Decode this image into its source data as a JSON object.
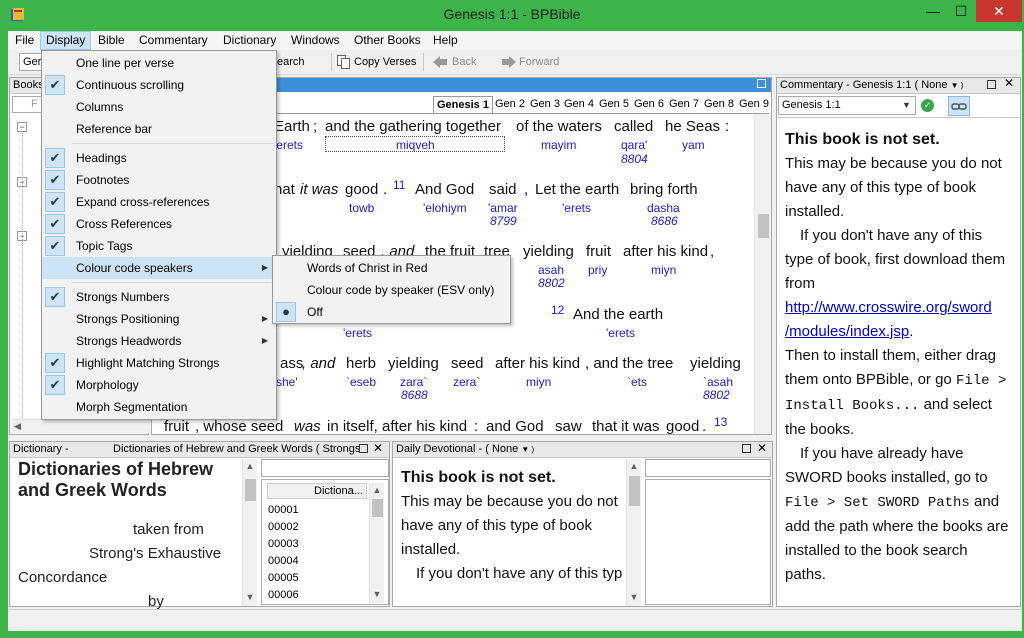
{
  "window": {
    "title": "Genesis 1:1 - BPBible",
    "min_label": "—",
    "max_label": "☐",
    "close_label": "✕"
  },
  "menubar": [
    "File",
    "Display",
    "Bible",
    "Commentary",
    "Dictionary",
    "Windows",
    "Other Books",
    "Help"
  ],
  "toolbar": {
    "book_field": "Ger",
    "search_label": "earch",
    "copy_verses": "Copy Verses",
    "back": "Back",
    "forward": "Forward"
  },
  "books_panel": {
    "title": "Books",
    "filter_placeholder": "F"
  },
  "bible": {
    "tabs": [
      "Genesis 1",
      "Gen 2",
      "Gen 3",
      "Gen 4",
      "Gen 5",
      "Gen 6",
      "Gen 7",
      "Gen 8",
      "Gen 9"
    ],
    "line1": {
      "words": [
        "Earth",
        ";",
        "and the gathering together",
        "of the waters",
        "called",
        "he Seas",
        ":"
      ],
      "strongs": [
        "'erets",
        "miqveh",
        "mayim",
        "qara'",
        "yam"
      ],
      "num": "8804"
    },
    "line2": {
      "words": [
        "nat",
        "it was",
        "good",
        ".",
        "And God",
        "said",
        ",",
        "Let the earth",
        "bring forth"
      ],
      "verse": "11",
      "strongs": [
        "towb",
        "'elohiym",
        "'amar",
        "'erets",
        "dasha"
      ],
      "nums": [
        "8799",
        "8686"
      ]
    },
    "line3": {
      "words": [
        "yielding",
        "seed",
        ", and",
        "the fruit",
        "tree",
        "yielding",
        "fruit",
        "after his kind",
        ","
      ],
      "strongs": [
        "asah",
        "priy",
        "miyn"
      ],
      "num": "8802"
    },
    "line4": {
      "words": [
        "And the earth"
      ],
      "verse": "12",
      "strongs": [
        "'erets",
        "'erets"
      ]
    },
    "line5": {
      "words": [
        "ass",
        ", and",
        "herb",
        "yielding",
        "seed",
        "after his kind",
        ", and the tree",
        "yielding"
      ],
      "strongs": [
        "she'",
        "`eseb",
        "zara`",
        "zera`",
        "miyn",
        "`ets",
        "`asah"
      ],
      "nums": [
        "8688",
        "8802"
      ]
    },
    "line6": {
      "words": [
        "fruit",
        ", whose seed",
        "was",
        "in itself, after his kind",
        ":",
        "and God",
        "saw",
        "that it was",
        "good",
        "."
      ],
      "verse": "13"
    }
  },
  "commentary": {
    "title": "Commentary - Genesis 1:1",
    "module": "( None",
    "ref": "Genesis 1:1",
    "heading": "This book is not set.",
    "p1": "This may be because you do not have any of this type of book installed.",
    "p2": "If you don't have any of this type of book, first download them from",
    "link1": "http://www.crosswire.org/sword",
    "link2": "/modules/index.jsp",
    "p3a": "Then to install them, either drag them onto BPBible, or go",
    "p3b": "File > Install Books...",
    "p3c": "and select the books.",
    "p4a": "If you have already have SWORD books installed, go to",
    "p4b": "File > Set SWORD Paths",
    "p4c": "and add the path where the books are installed to the book search paths."
  },
  "dictionary": {
    "title": "Dictionary -",
    "subtitle": "Dictionaries of Hebrew and Greek Words ( Strongs",
    "heading": "Dictionaries of Hebrew and Greek Words",
    "line1": "taken from",
    "line2": "Strong's Exhaustive",
    "line3": "Concordance",
    "line4": "by",
    "list_header": "Dictiona...",
    "entries": [
      "00001",
      "00002",
      "00003",
      "00004",
      "00005",
      "00006"
    ]
  },
  "devotional": {
    "title": "Daily Devotional -",
    "module": "( None",
    "heading": "This book is not set.",
    "p1": "This may be because you do not have any of this type of book installed.",
    "p2": "If you don't have any of this type of book, first download"
  },
  "display_menu": {
    "items": [
      {
        "label": "One line per verse",
        "checked": false
      },
      {
        "label": "Continuous scrolling",
        "checked": true
      },
      {
        "label": "Columns",
        "checked": false
      },
      {
        "label": "Reference bar",
        "checked": false
      },
      {
        "label": "Headings",
        "checked": true
      },
      {
        "label": "Footnotes",
        "checked": true
      },
      {
        "label": "Expand cross-references",
        "checked": true
      },
      {
        "label": "Cross References",
        "checked": true
      },
      {
        "label": "Topic Tags",
        "checked": true
      },
      {
        "label": "Colour code speakers",
        "checked": false,
        "submenu": true
      },
      {
        "label": "Strongs Numbers",
        "checked": true
      },
      {
        "label": "Strongs Positioning",
        "checked": false,
        "submenu": true
      },
      {
        "label": "Strongs Headwords",
        "checked": false,
        "submenu": true
      },
      {
        "label": "Highlight Matching Strongs",
        "checked": true
      },
      {
        "label": "Morphology",
        "checked": true
      },
      {
        "label": "Morph Segmentation",
        "checked": false
      }
    ]
  },
  "colour_submenu": {
    "items": [
      {
        "label": "Words of Christ in Red",
        "selected": false
      },
      {
        "label": "Colour code by speaker (ESV only)",
        "selected": false
      },
      {
        "label": "Off",
        "selected": true
      }
    ]
  },
  "colors": {
    "titlebar": "#3cb44a",
    "menu_highlight": "#cce4f7",
    "strongs_blue": "#1a1adc",
    "link": "#0000cc"
  }
}
